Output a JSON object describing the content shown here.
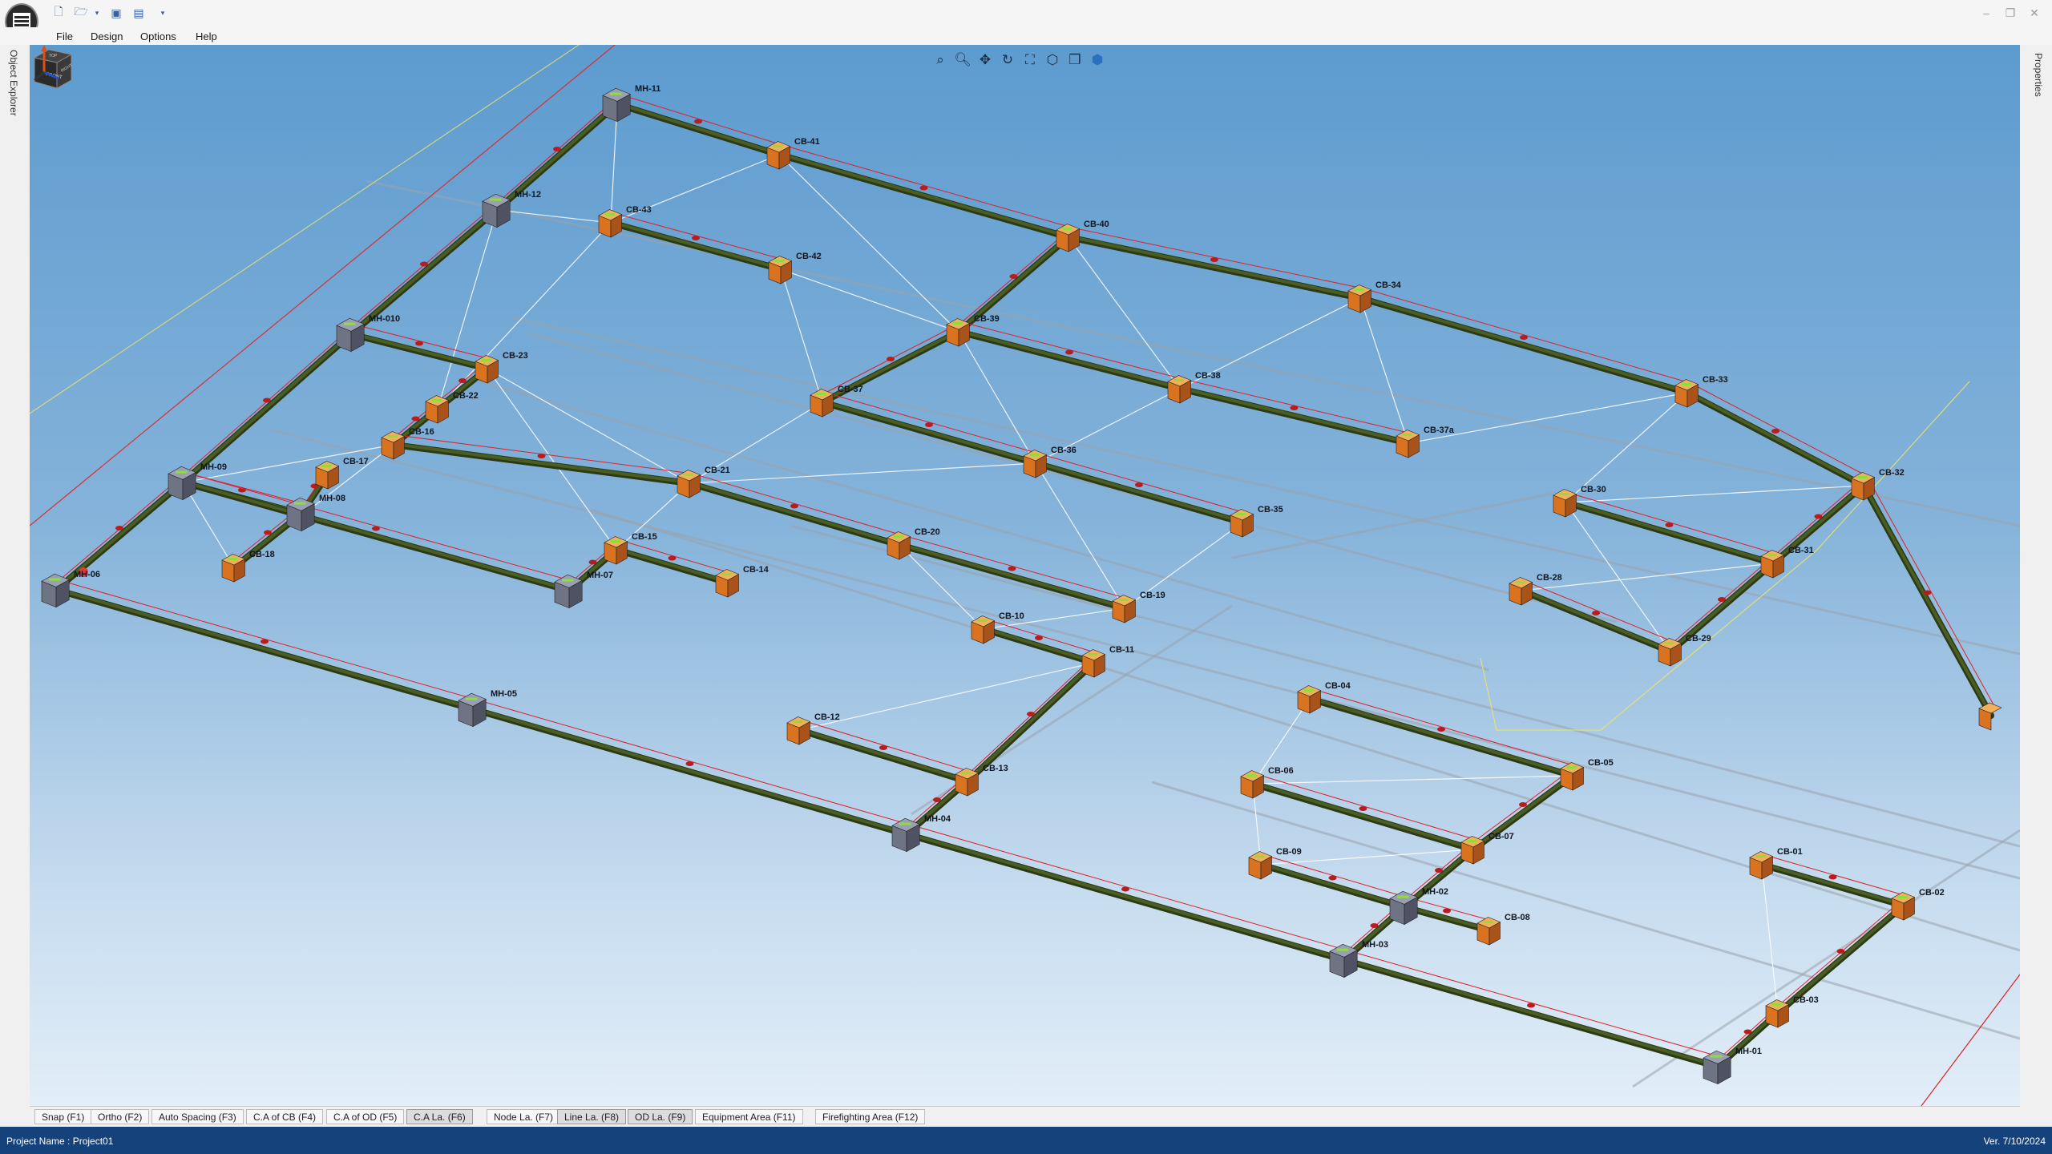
{
  "menu": [
    "File",
    "Design",
    "Options",
    "Help"
  ],
  "panels": {
    "left": "Object Explorer",
    "right": "Properties"
  },
  "cube": {
    "front": "FRONT",
    "right": "RIGHT",
    "top": "TOP"
  },
  "bottom_tabs": [
    {
      "label": "Snap (F1)",
      "active": false
    },
    {
      "label": "Ortho (F2)",
      "active": false
    },
    {
      "label": "Auto Spacing (F3)",
      "active": false
    },
    {
      "label": "C.A of CB (F4)",
      "active": false
    },
    {
      "label": "C.A of OD (F5)",
      "active": false
    },
    {
      "label": "C.A La. (F6)",
      "active": true
    },
    {
      "label": "Node La. (F7)",
      "active": false
    },
    {
      "label": "Line La. (F8)",
      "active": true
    },
    {
      "label": "OD La. (F9)",
      "active": true
    },
    {
      "label": "Equipment Area (F11)",
      "active": false
    },
    {
      "label": "Firefighting Area (F12)",
      "active": false
    }
  ],
  "status": {
    "project": "Project Name : Project01",
    "version": "Ver. 7/10/2024"
  },
  "colors": {
    "viewport_top": "#5d9bcf",
    "pipe": "#4a5d24",
    "catch_basin": "#d9731f",
    "manhole": "#6f7485",
    "boundary": "#e0202a",
    "status_bar": "#16427c"
  },
  "nodes": {
    "MH-11": "MH-11",
    "MH-12": "MH-12",
    "MH-010": "MH-010",
    "MH-09": "MH-09",
    "MH-08": "MH-08",
    "MH-06": "MH-06",
    "MH-07": "MH-07",
    "MH-05": "MH-05",
    "MH-04": "MH-04",
    "MH-03": "MH-03",
    "MH-02": "MH-02",
    "MH-01": "MH-01",
    "CB-41": "CB-41",
    "CB-40": "CB-40",
    "CB-43": "CB-43",
    "CB-42": "CB-42",
    "CB-34": "CB-34",
    "CB-39": "CB-39",
    "CB-33": "CB-33",
    "CB-23": "CB-23",
    "CB-22": "CB-22",
    "CB-38": "CB-38",
    "CB-37": "CB-37",
    "CB-37a": "CB-37a",
    "CB-16": "CB-16",
    "CB-17": "CB-17",
    "CB-36": "CB-36",
    "CB-21": "CB-21",
    "CB-32": "CB-32",
    "CB-30": "CB-30",
    "CB-35": "CB-35",
    "CB-18": "CB-18",
    "CB-15": "CB-15",
    "CB-20": "CB-20",
    "CB-31": "CB-31",
    "CB-14": "CB-14",
    "CB-28": "CB-28",
    "CB-19": "CB-19",
    "CB-10": "CB-10",
    "CB-29": "CB-29",
    "CB-11": "CB-11",
    "CB-04": "CB-04",
    "CB-12": "CB-12",
    "CB-05": "CB-05",
    "CB-13": "CB-13",
    "CB-06": "CB-06",
    "CB-07": "CB-07",
    "CB-09": "CB-09",
    "CB-01": "CB-01",
    "CB-02": "CB-02",
    "CB-08": "CB-08",
    "CB-03": "CB-03"
  }
}
